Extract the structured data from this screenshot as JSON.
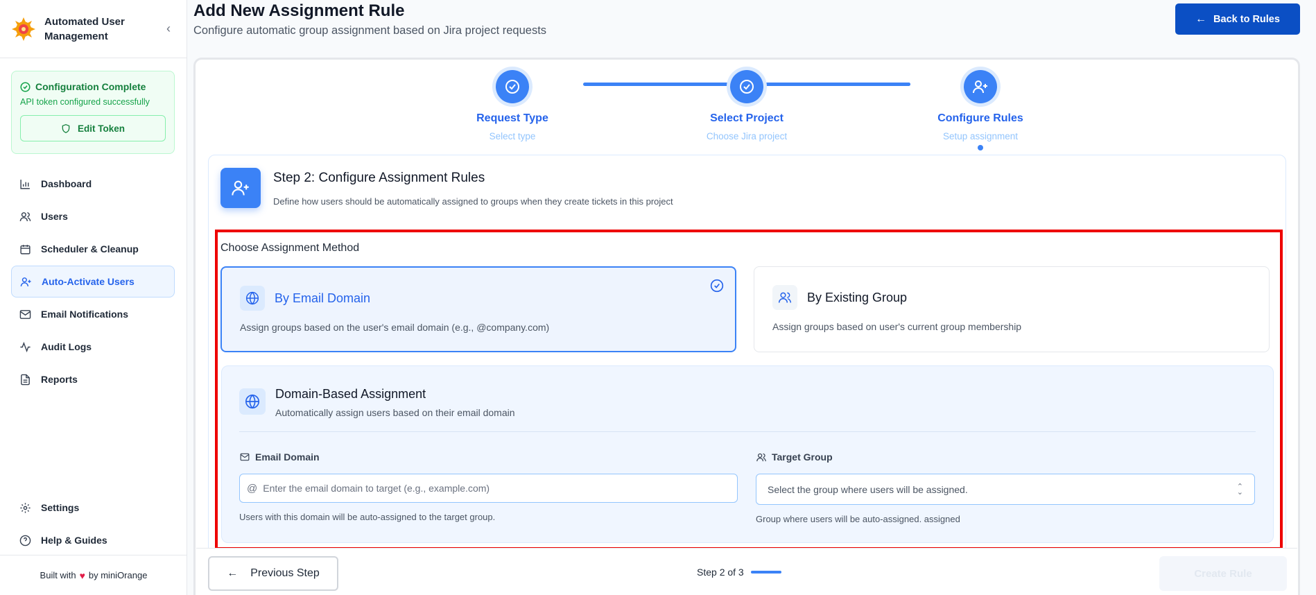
{
  "sidebar": {
    "brand_title": "Automated User Management",
    "config": {
      "title": "Configuration Complete",
      "subtitle": "API token configured successfully",
      "edit_label": "Edit Token"
    },
    "items": [
      {
        "label": "Dashboard",
        "icon": "bar-chart-icon"
      },
      {
        "label": "Users",
        "icon": "users-icon"
      },
      {
        "label": "Scheduler & Cleanup",
        "icon": "calendar-icon"
      },
      {
        "label": "Auto-Activate Users",
        "icon": "user-plus-icon",
        "active": true
      },
      {
        "label": "Email Notifications",
        "icon": "mail-icon"
      },
      {
        "label": "Audit Logs",
        "icon": "activity-icon"
      },
      {
        "label": "Reports",
        "icon": "file-text-icon"
      }
    ],
    "bottom_items": [
      {
        "label": "Settings",
        "icon": "gear-icon"
      },
      {
        "label": "Help & Guides",
        "icon": "help-circle-icon"
      }
    ],
    "footer": {
      "prefix": "Built with",
      "suffix": "by miniOrange"
    }
  },
  "header": {
    "title": "Add New Assignment Rule",
    "subtitle": "Configure automatic group assignment based on Jira project requests",
    "back_label": "Back to Rules"
  },
  "stepper": [
    {
      "label": "Request Type",
      "sub": "Select type",
      "state": "done"
    },
    {
      "label": "Select Project",
      "sub": "Choose Jira project",
      "state": "done"
    },
    {
      "label": "Configure Rules",
      "sub": "Setup assignment",
      "state": "current"
    }
  ],
  "panel": {
    "title": "Step 2: Configure Assignment Rules",
    "description": "Define how users should be automatically assigned to groups when they create tickets in this project",
    "method_label": "Choose Assignment Method",
    "methods": [
      {
        "title": "By Email Domain",
        "description": "Assign groups based on the user's email domain (e.g., @company.com)",
        "selected": true
      },
      {
        "title": "By Existing Group",
        "description": "Assign groups based on user's current group membership",
        "selected": false
      }
    ],
    "domain": {
      "title": "Domain-Based Assignment",
      "description": "Automatically assign users based on their email domain",
      "email_label": "Email Domain",
      "email_placeholder": "Enter the email domain to target (e.g., example.com)",
      "email_hint": "Users with this domain will be auto-assigned to the target group.",
      "group_label": "Target Group",
      "group_placeholder": "Select the group where users will be assigned.",
      "group_hint": "Group where users will be auto-assigned. assigned"
    }
  },
  "footer": {
    "prev_label": "Previous Step",
    "step_count": "Step 2 of 3",
    "create_label": "Create Rule"
  },
  "colors": {
    "accent": "#3b82f6",
    "primary_button": "#0b4fc4",
    "success": "#15803d",
    "highlight": "#ee0000"
  }
}
